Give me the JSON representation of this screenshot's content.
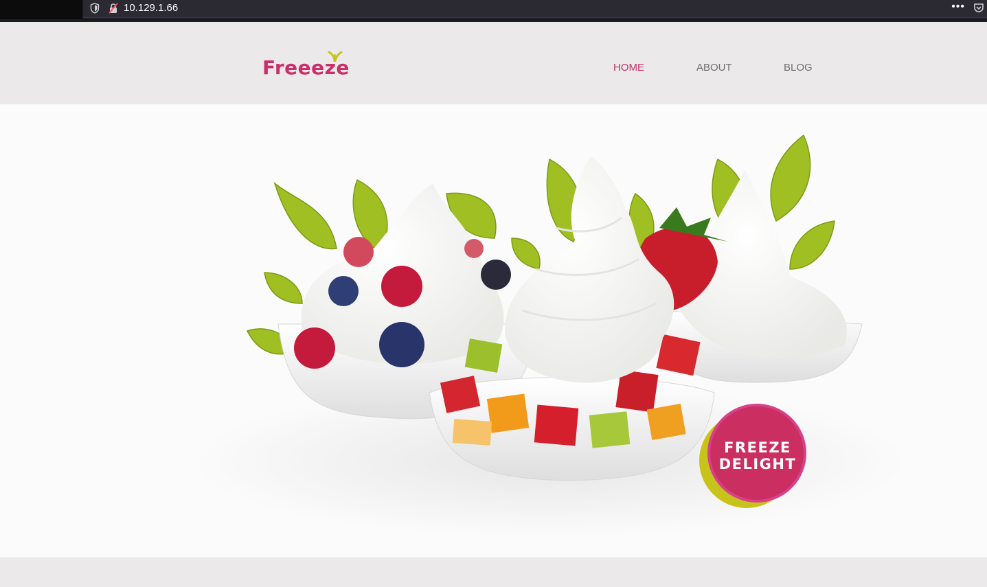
{
  "browser": {
    "url": "10.129.1.66",
    "menu_icon": "ellipsis-icon",
    "pocket_icon": "pocket-icon"
  },
  "site": {
    "logo_text": "Freeeze",
    "brand_color": "#cb2f6a",
    "nav": [
      {
        "label": "HOME",
        "active": true
      },
      {
        "label": "ABOUT",
        "active": false
      },
      {
        "label": "BLOG",
        "active": false
      }
    ]
  },
  "hero": {
    "badge_line1": "FREEZE",
    "badge_line2": "DELIGHT",
    "badge_color": "#cb2f62",
    "badge_accent": "#c7c31a"
  }
}
